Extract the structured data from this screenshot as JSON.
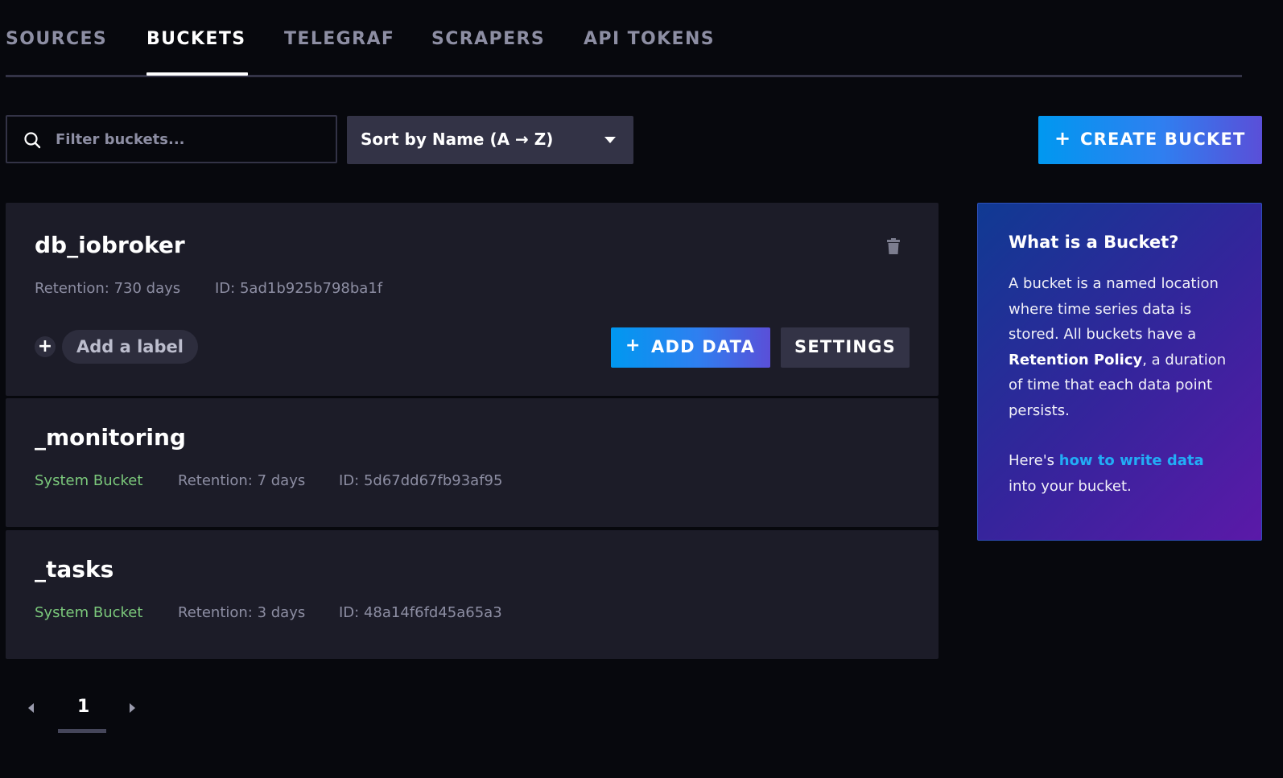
{
  "tabs": [
    {
      "label": "SOURCES",
      "active": false
    },
    {
      "label": "BUCKETS",
      "active": true
    },
    {
      "label": "TELEGRAF",
      "active": false
    },
    {
      "label": "SCRAPERS",
      "active": false
    },
    {
      "label": "API TOKENS",
      "active": false
    }
  ],
  "toolbar": {
    "search_placeholder": "Filter buckets...",
    "search_value": "",
    "sort_label": "Sort by Name (A → Z)",
    "create_plus": "+",
    "create_label": "CREATE BUCKET"
  },
  "buckets": [
    {
      "name": "db_iobroker",
      "retention": "Retention: 730 days",
      "id": "ID: 5ad1b925b798ba1f",
      "add_label": "Add a label",
      "add_label_plus": "+",
      "add_data_plus": "+",
      "add_data_label": "ADD DATA",
      "settings_label": "SETTINGS",
      "trash_icon": "trash-icon"
    },
    {
      "name": "_monitoring",
      "system_label": "System Bucket",
      "retention": "Retention: 7 days",
      "id": "ID: 5d67dd67fb93af95"
    },
    {
      "name": "_tasks",
      "system_label": "System Bucket",
      "retention": "Retention: 3 days",
      "id": "ID: 48a14f6fd45a65a3"
    }
  ],
  "info": {
    "title": "What is a Bucket?",
    "body_pre": "A bucket is a named location where time series data is stored. All buckets have a ",
    "body_bold": "Retention Policy",
    "body_post": ", a duration of time that each data point persists.",
    "link_pre": "Here's ",
    "link_text": "how to write data",
    "link_post": " into your bucket."
  },
  "pagination": {
    "current_page": "1"
  },
  "colors": {
    "background": "#07080d",
    "card": "#1c1c28",
    "accent_blue": "#0098f0",
    "system_green": "#7bc87b",
    "link_blue": "#22adf6"
  }
}
